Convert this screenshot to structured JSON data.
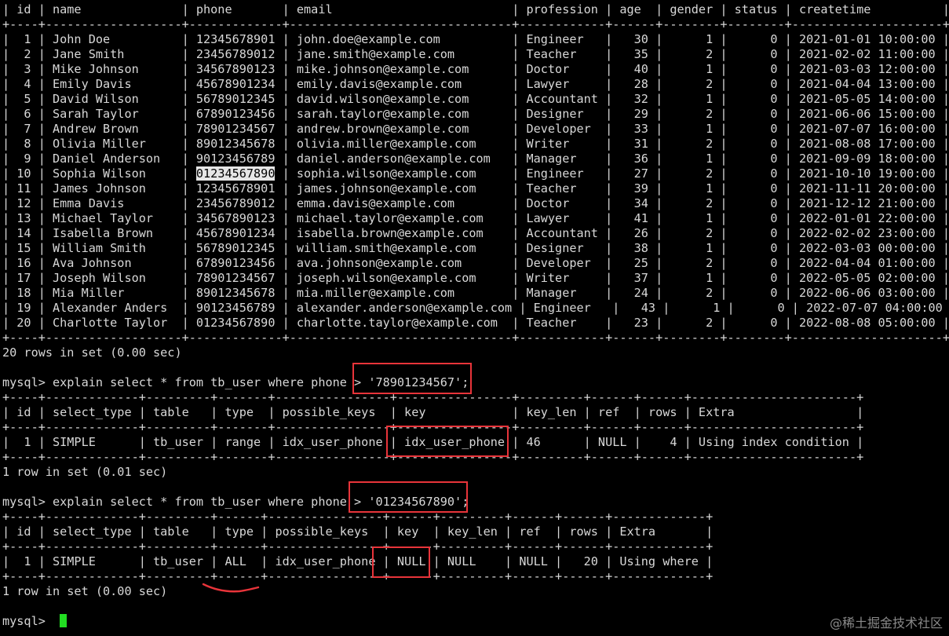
{
  "terminal": {
    "lines": [
      {
        "text": "| id | name              | phone       | email                         | profession | age  | gender | status | createtime          |"
      },
      {
        "text": "+----+-------------------+-------------+-------------------------------+------------+------+--------+--------+---------------------+"
      },
      {
        "text": "|  1 | John Doe          | 12345678901 | john.doe@example.com          | Engineer   |   30 |      1 |      0 | 2021-01-01 10:00:00 |"
      },
      {
        "text": "|  2 | Jane Smith        | 23456789012 | jane.smith@example.com        | Teacher    |   35 |      2 |      0 | 2021-02-02 11:00:00 |"
      },
      {
        "text": "|  3 | Mike Johnson      | 34567890123 | mike.johnson@example.com      | Doctor     |   40 |      1 |      0 | 2021-03-03 12:00:00 |"
      },
      {
        "text": "|  4 | Emily Davis       | 45678901234 | emily.davis@example.com       | Lawyer     |   28 |      2 |      0 | 2021-04-04 13:00:00 |"
      },
      {
        "text": "|  5 | David Wilson      | 56789012345 | david.wilson@example.com      | Accountant |   32 |      1 |      0 | 2021-05-05 14:00:00 |"
      },
      {
        "text": "|  6 | Sarah Taylor      | 67890123456 | sarah.taylor@example.com      | Designer   |   29 |      2 |      0 | 2021-06-06 15:00:00 |"
      },
      {
        "text": "|  7 | Andrew Brown      | 78901234567 | andrew.brown@example.com      | Developer  |   33 |      1 |      0 | 2021-07-07 16:00:00 |"
      },
      {
        "text": "|  8 | Olivia Miller     | 89012345678 | olivia.miller@example.com     | Writer     |   31 |      2 |      0 | 2021-08-08 17:00:00 |"
      },
      {
        "text": "|  9 | Daniel Anderson   | 90123456789 | daniel.anderson@example.com   | Manager    |   36 |      1 |      0 | 2021-09-09 18:00:00 |"
      },
      {
        "text": "| 10 | Sophia Wilson     | ",
        "hl": "01234567890",
        "rest": " | sophia.wilson@example.com     | Engineer   |   27 |      2 |      0 | 2021-10-10 19:00:00 |"
      },
      {
        "text": "| 11 | James Johnson     | 12345678901 | james.johnson@example.com     | Teacher    |   39 |      1 |      0 | 2021-11-11 20:00:00 |"
      },
      {
        "text": "| 12 | Emma Davis        | 23456789012 | emma.davis@example.com        | Doctor     |   34 |      2 |      0 | 2021-12-12 21:00:00 |"
      },
      {
        "text": "| 13 | Michael Taylor    | 34567890123 | michael.taylor@example.com    | Lawyer     |   41 |      1 |      0 | 2022-01-01 22:00:00 |"
      },
      {
        "text": "| 14 | Isabella Brown    | 45678901234 | isabella.brown@example.com    | Accountant |   26 |      2 |      0 | 2022-02-02 23:00:00 |"
      },
      {
        "text": "| 15 | William Smith     | 56789012345 | william.smith@example.com     | Designer   |   38 |      1 |      0 | 2022-03-03 00:00:00 |"
      },
      {
        "text": "| 16 | Ava Johnson       | 67890123456 | ava.johnson@example.com       | Developer  |   25 |      2 |      0 | 2022-04-04 01:00:00 |"
      },
      {
        "text": "| 17 | Joseph Wilson     | 78901234567 | joseph.wilson@example.com     | Writer     |   37 |      1 |      0 | 2022-05-05 02:00:00 |"
      },
      {
        "text": "| 18 | Mia Miller        | 89012345678 | mia.miller@example.com        | Manager    |   24 |      2 |      0 | 2022-06-06 03:00:00 |"
      },
      {
        "text": "| 19 | Alexander Anders  | 90123456789 | alexander.anderson@example.com | Engineer   |   43 |      1 |      0 | 2022-07-07 04:00:00 |"
      },
      {
        "text": "| 20 | Charlotte Taylor  | 01234567890 | charlotte.taylor@example.com  | Teacher    |   23 |      2 |      0 | 2022-08-08 05:00:00 |"
      },
      {
        "text": "+----+-------------------+-------------+-------------------------------+------------+------+--------+--------+---------------------+"
      },
      {
        "text": "20 rows in set (0.00 sec)"
      },
      {
        "text": ""
      },
      {
        "text": "mysql> explain select * from tb_user where phone > '78901234567';"
      },
      {
        "text": "+----+-------------+---------+-------+----------------+----------------+---------+------+------+-----------------------+"
      },
      {
        "text": "| id | select_type | table   | type  | possible_keys  | key            | key_len | ref  | rows | Extra                 |"
      },
      {
        "text": "+----+-------------+---------+-------+----------------+----------------+---------+------+------+-----------------------+"
      },
      {
        "text": "|  1 | SIMPLE      | tb_user | range | idx_user_phone | idx_user_phone | 46      | NULL |    4 | Using index condition |"
      },
      {
        "text": "+----+-------------+---------+-------+----------------+----------------+---------+------+------+-----------------------+"
      },
      {
        "text": "1 row in set (0.01 sec)"
      },
      {
        "text": ""
      },
      {
        "text": "mysql> explain select * from tb_user where phone > '01234567890';"
      },
      {
        "text": "+----+-------------+---------+------+----------------+------+---------+------+------+-------------+"
      },
      {
        "text": "| id | select_type | table   | type | possible_keys  | key  | key_len | ref  | rows | Extra       |"
      },
      {
        "text": "+----+-------------+---------+------+----------------+------+---------+------+------+-------------+"
      },
      {
        "text": "|  1 | SIMPLE      | tb_user | ALL  | idx_user_phone | NULL | NULL    | NULL |   20 | Using where |"
      },
      {
        "text": "+----+-------------+---------+------+----------------+------+---------+------+------+-------------+"
      },
      {
        "text": "1 row in set (0.00 sec)"
      },
      {
        "text": ""
      },
      {
        "text": "mysql> ",
        "cursor": true
      }
    ]
  },
  "colors": {
    "background": "#000000",
    "foreground": "#d8d8d8",
    "cursor": "#22dd22",
    "annotation": "#e8343a"
  },
  "watermark": "@稀土掘金技术社区"
}
